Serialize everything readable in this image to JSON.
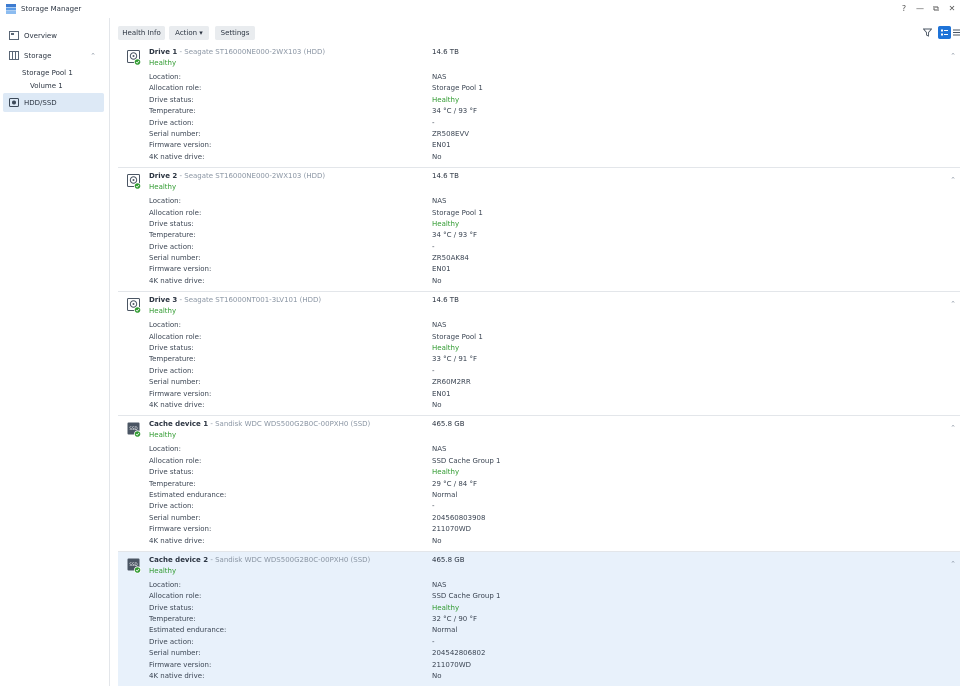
{
  "window": {
    "title": "Storage Manager",
    "controls": [
      "?",
      "—",
      "⧉",
      "✕"
    ]
  },
  "sidebar": {
    "overview_label": "Overview",
    "storage_label": "Storage",
    "pool_label": "Storage Pool 1",
    "volume_label": "Volume 1",
    "hddssd_label": "HDD/SSD"
  },
  "toolbar": {
    "health_info": "Health Info",
    "action": "Action ▾",
    "settings": "Settings"
  },
  "colors": {
    "healthy": "#2f9a2f",
    "selected_bg": "#e8f1fb",
    "accent": "#1e73d8"
  },
  "drives": [
    {
      "name": "Drive 1",
      "model": " - Seagate ST16000NE000-2WX103 (HDD)",
      "status": "Healthy",
      "size": "14.6 TB",
      "kind": "hdd",
      "props": [
        [
          "Location:",
          "NAS"
        ],
        [
          "Allocation role:",
          "Storage Pool 1"
        ],
        [
          "Drive status:",
          "Healthy"
        ],
        [
          "Temperature:",
          "34 °C / 93 °F"
        ],
        [
          "Drive action:",
          "-"
        ],
        [
          "Serial number:",
          "ZR508EVV"
        ],
        [
          "Firmware version:",
          "EN01"
        ],
        [
          "4K native drive:",
          "No"
        ]
      ]
    },
    {
      "name": "Drive 2",
      "model": " - Seagate ST16000NE000-2WX103 (HDD)",
      "status": "Healthy",
      "size": "14.6 TB",
      "kind": "hdd",
      "props": [
        [
          "Location:",
          "NAS"
        ],
        [
          "Allocation role:",
          "Storage Pool 1"
        ],
        [
          "Drive status:",
          "Healthy"
        ],
        [
          "Temperature:",
          "34 °C / 93 °F"
        ],
        [
          "Drive action:",
          "-"
        ],
        [
          "Serial number:",
          "ZR50AK84"
        ],
        [
          "Firmware version:",
          "EN01"
        ],
        [
          "4K native drive:",
          "No"
        ]
      ]
    },
    {
      "name": "Drive 3",
      "model": " - Seagate ST16000NT001-3LV101 (HDD)",
      "status": "Healthy",
      "size": "14.6 TB",
      "kind": "hdd",
      "props": [
        [
          "Location:",
          "NAS"
        ],
        [
          "Allocation role:",
          "Storage Pool 1"
        ],
        [
          "Drive status:",
          "Healthy"
        ],
        [
          "Temperature:",
          "33 °C / 91 °F"
        ],
        [
          "Drive action:",
          "-"
        ],
        [
          "Serial number:",
          "ZR60M2RR"
        ],
        [
          "Firmware version:",
          "EN01"
        ],
        [
          "4K native drive:",
          "No"
        ]
      ]
    },
    {
      "name": "Cache device 1",
      "model": " - Sandisk WDC WDS500G2B0C-00PXH0 (SSD)",
      "status": "Healthy",
      "size": "465.8 GB",
      "kind": "ssd",
      "props": [
        [
          "Location:",
          "NAS"
        ],
        [
          "Allocation role:",
          "SSD Cache Group 1"
        ],
        [
          "Drive status:",
          "Healthy"
        ],
        [
          "Temperature:",
          "29 °C / 84 °F"
        ],
        [
          "Estimated endurance:",
          "Normal"
        ],
        [
          "Drive action:",
          "-"
        ],
        [
          "Serial number:",
          "204560803908"
        ],
        [
          "Firmware version:",
          "211070WD"
        ],
        [
          "4K native drive:",
          "No"
        ]
      ]
    },
    {
      "name": "Cache device 2",
      "model": " - Sandisk WDC WDS500G2B0C-00PXH0 (SSD)",
      "status": "Healthy",
      "size": "465.8 GB",
      "kind": "ssd",
      "selected": true,
      "props": [
        [
          "Location:",
          "NAS"
        ],
        [
          "Allocation role:",
          "SSD Cache Group 1"
        ],
        [
          "Drive status:",
          "Healthy"
        ],
        [
          "Temperature:",
          "32 °C / 90 °F"
        ],
        [
          "Estimated endurance:",
          "Normal"
        ],
        [
          "Drive action:",
          "-"
        ],
        [
          "Serial number:",
          "204542806802"
        ],
        [
          "Firmware version:",
          "211070WD"
        ],
        [
          "4K native drive:",
          "No"
        ]
      ]
    }
  ]
}
